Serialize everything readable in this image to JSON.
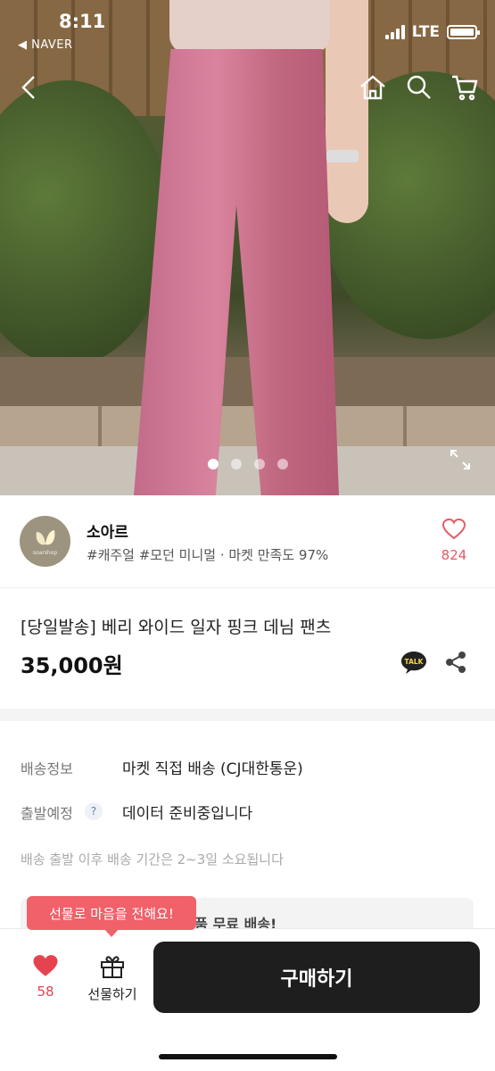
{
  "status": {
    "time": "8:11",
    "back_app": "◀ NAVER",
    "network": "LTE"
  },
  "nav": {
    "icons": [
      "back-icon",
      "home-icon",
      "search-icon",
      "cart-icon"
    ]
  },
  "gallery": {
    "total": 4,
    "active": 1
  },
  "shop": {
    "name": "소아르",
    "tags": "#캐주얼 #모던 미니멀 · 마켓 만족도 97%",
    "logo_text": "soarshop",
    "likes": "824"
  },
  "product": {
    "title": "[당일발송] 베리 와이드 일자 핑크 데님 팬츠",
    "price": "35,000원",
    "talk_label": "TALK"
  },
  "delivery": {
    "shipping_label": "배송정보",
    "shipping_value": "마켓 직접 배송 (CJ대한통운)",
    "departure_label": "출발예정",
    "departure_value": "데이터 준비중입니다",
    "note": "배송 출발 이후 배송 기간은 2~3일 소요됩니다",
    "banner_partial": "이 전 상품 무료 배송!"
  },
  "bottom": {
    "tooltip": "선물로 마음을 전해요!",
    "like_count": "58",
    "gift_label": "선물하기",
    "buy_label": "구매하기"
  },
  "colors": {
    "accent": "#e45a67",
    "buy_button": "#1e1e1e",
    "tooltip": "#f0616a"
  }
}
